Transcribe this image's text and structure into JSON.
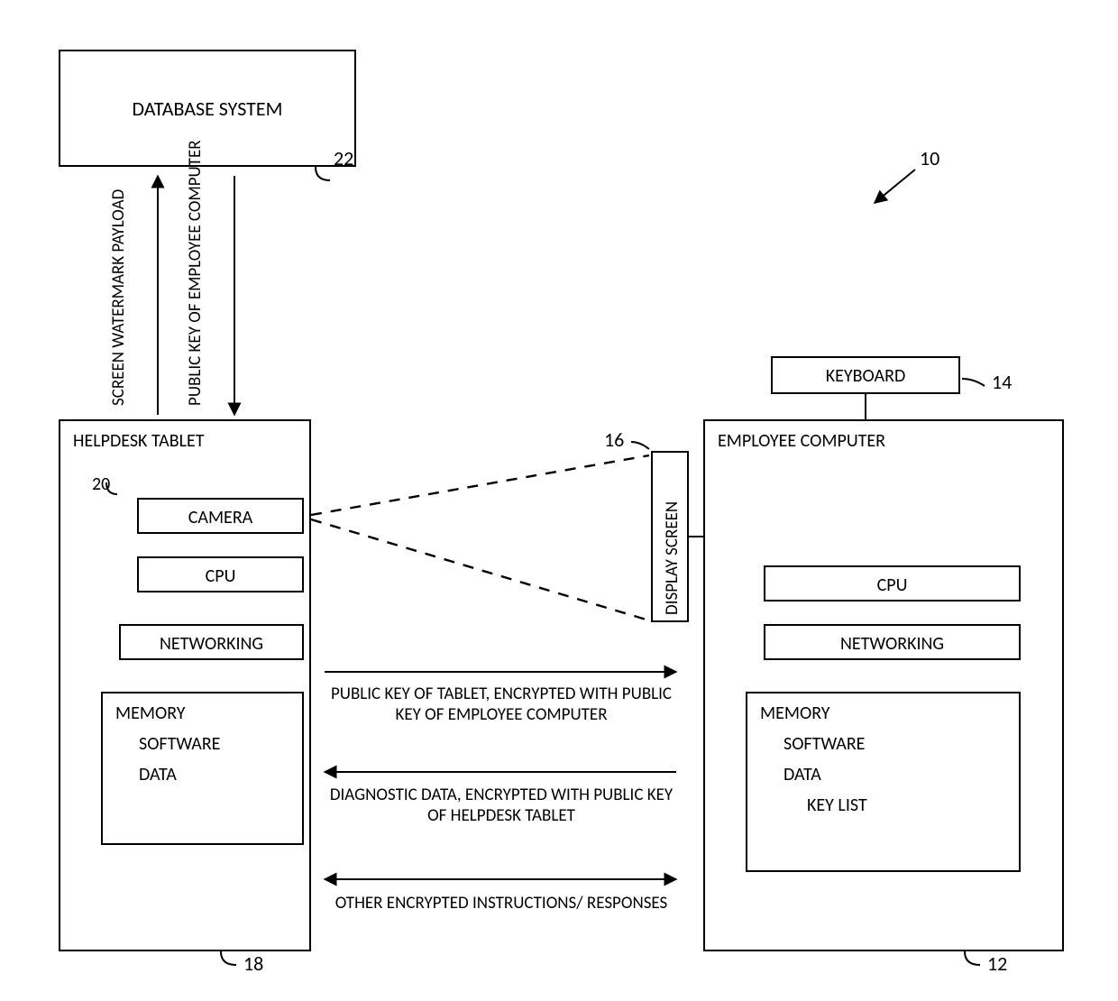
{
  "figure_ref": "10",
  "database": {
    "title": "DATABASE SYSTEM",
    "ref": "22"
  },
  "db_links": {
    "up": "SCREEN WATERMARK PAYLOAD",
    "down": "PUBLIC KEY OF EMPLOYEE COMPUTER"
  },
  "tablet": {
    "title": "HELPDESK TABLET",
    "ref": "18",
    "camera": {
      "label": "CAMERA",
      "ref": "20"
    },
    "cpu": {
      "label": "CPU"
    },
    "net": {
      "label": "NETWORKING"
    },
    "memory": {
      "label": "MEMORY",
      "sw": "SOFTWARE",
      "data": "DATA"
    }
  },
  "employee": {
    "title": "EMPLOYEE COMPUTER",
    "ref": "12",
    "keyboard": {
      "label": "KEYBOARD",
      "ref": "14"
    },
    "display": {
      "label": "DISPLAY SCREEN",
      "ref": "16"
    },
    "cpu": {
      "label": "CPU"
    },
    "net": {
      "label": "NETWORKING"
    },
    "memory": {
      "label": "MEMORY",
      "sw": "SOFTWARE",
      "data": "DATA",
      "keylist": "KEY LIST"
    }
  },
  "flows": {
    "right": "PUBLIC KEY OF TABLET, ENCRYPTED WITH PUBLIC KEY OF EMPLOYEE COMPUTER",
    "left": "DIAGNOSTIC DATA, ENCRYPTED WITH PUBLIC KEY OF HELPDESK TABLET",
    "both": "OTHER ENCRYPTED INSTRUCTIONS/ RESPONSES"
  }
}
